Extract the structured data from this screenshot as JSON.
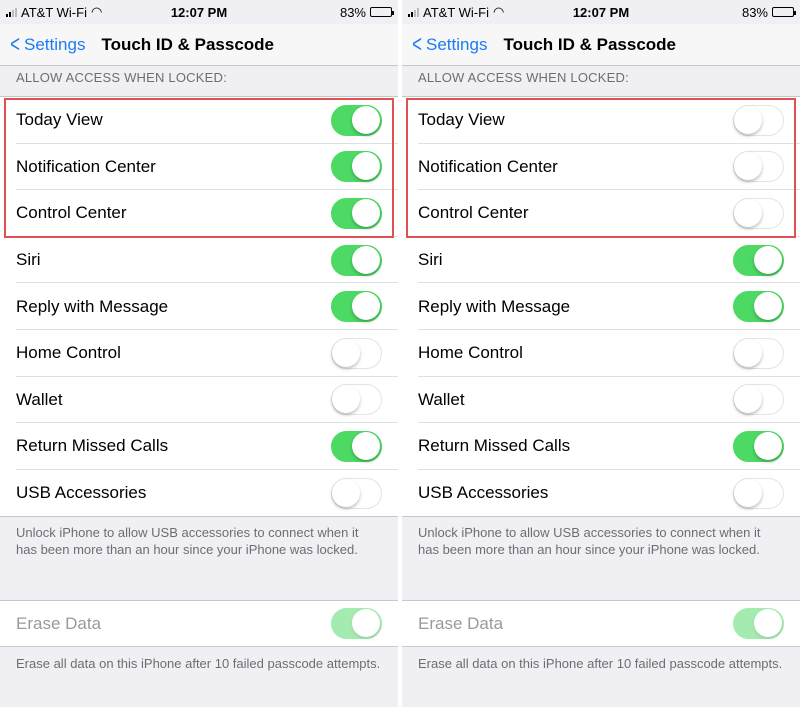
{
  "status_bar": {
    "carrier": "AT&T Wi-Fi",
    "time": "12:07 PM",
    "battery": "83%"
  },
  "nav": {
    "back_label": "Settings",
    "title": "Touch ID & Passcode"
  },
  "section_header": "ALLOW ACCESS WHEN LOCKED:",
  "usb_footnote": "Unlock iPhone to allow USB accessories to connect when it has been more than an hour since your iPhone was locked.",
  "erase": {
    "label": "Erase Data",
    "footnote": "Erase all data on this iPhone after 10 failed passcode attempts."
  },
  "colors": {
    "accent": "#1a7cf5",
    "toggle_on": "#4cd964",
    "highlight": "#e05252"
  },
  "screens": [
    {
      "rows": [
        {
          "label": "Today View",
          "on": true
        },
        {
          "label": "Notification Center",
          "on": true
        },
        {
          "label": "Control Center",
          "on": true
        },
        {
          "label": "Siri",
          "on": true
        },
        {
          "label": "Reply with Message",
          "on": true
        },
        {
          "label": "Home Control",
          "on": false
        },
        {
          "label": "Wallet",
          "on": false
        },
        {
          "label": "Return Missed Calls",
          "on": true
        },
        {
          "label": "USB Accessories",
          "on": false
        }
      ],
      "erase_on": true
    },
    {
      "rows": [
        {
          "label": "Today View",
          "on": false
        },
        {
          "label": "Notification Center",
          "on": false
        },
        {
          "label": "Control Center",
          "on": false
        },
        {
          "label": "Siri",
          "on": true
        },
        {
          "label": "Reply with Message",
          "on": true
        },
        {
          "label": "Home Control",
          "on": false
        },
        {
          "label": "Wallet",
          "on": false
        },
        {
          "label": "Return Missed Calls",
          "on": true
        },
        {
          "label": "USB Accessories",
          "on": false
        }
      ],
      "erase_on": true
    }
  ]
}
